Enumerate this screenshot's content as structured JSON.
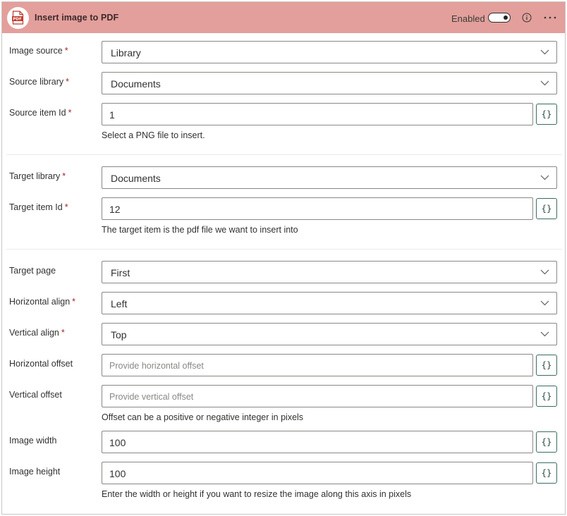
{
  "header": {
    "title": "Insert image to PDF",
    "logo_icon": "pdf-file-icon",
    "logo_text": "PDF",
    "enabled_label": "Enabled",
    "enabled": true,
    "info_icon": "info-icon",
    "more_icon": "more-options-icon",
    "brand_color": "#e39f9b"
  },
  "fields": {
    "image_source": {
      "label": "Image source",
      "required": "*",
      "value": "Library"
    },
    "source_library": {
      "label": "Source library",
      "required": "*",
      "value": "Documents"
    },
    "source_item_id": {
      "label": "Source item Id",
      "required": "*",
      "value": "1",
      "hint": "Select a PNG file to insert."
    },
    "target_library": {
      "label": "Target library",
      "required": "*",
      "value": "Documents"
    },
    "target_item_id": {
      "label": "Target item Id",
      "required": "*",
      "value": "12",
      "hint": "The target item is the pdf file we want to insert into"
    },
    "target_page": {
      "label": "Target page",
      "value": "First"
    },
    "horizontal_align": {
      "label": "Horizontal align",
      "required": "*",
      "value": "Left"
    },
    "vertical_align": {
      "label": "Vertical align",
      "required": "*",
      "value": "Top"
    },
    "horizontal_offset": {
      "label": "Horizontal offset",
      "placeholder": "Provide horizontal offset"
    },
    "vertical_offset": {
      "label": "Vertical offset",
      "placeholder": "Provide vertical offset",
      "hint": "Offset can be a positive or negative integer in pixels"
    },
    "image_width": {
      "label": "Image width",
      "value": "100"
    },
    "image_height": {
      "label": "Image height",
      "value": "100",
      "hint": "Enter the width or height if you want to resize the image along this axis in pixels"
    }
  },
  "dynamic_content_button": "{}",
  "accent_color": "#a4262c"
}
